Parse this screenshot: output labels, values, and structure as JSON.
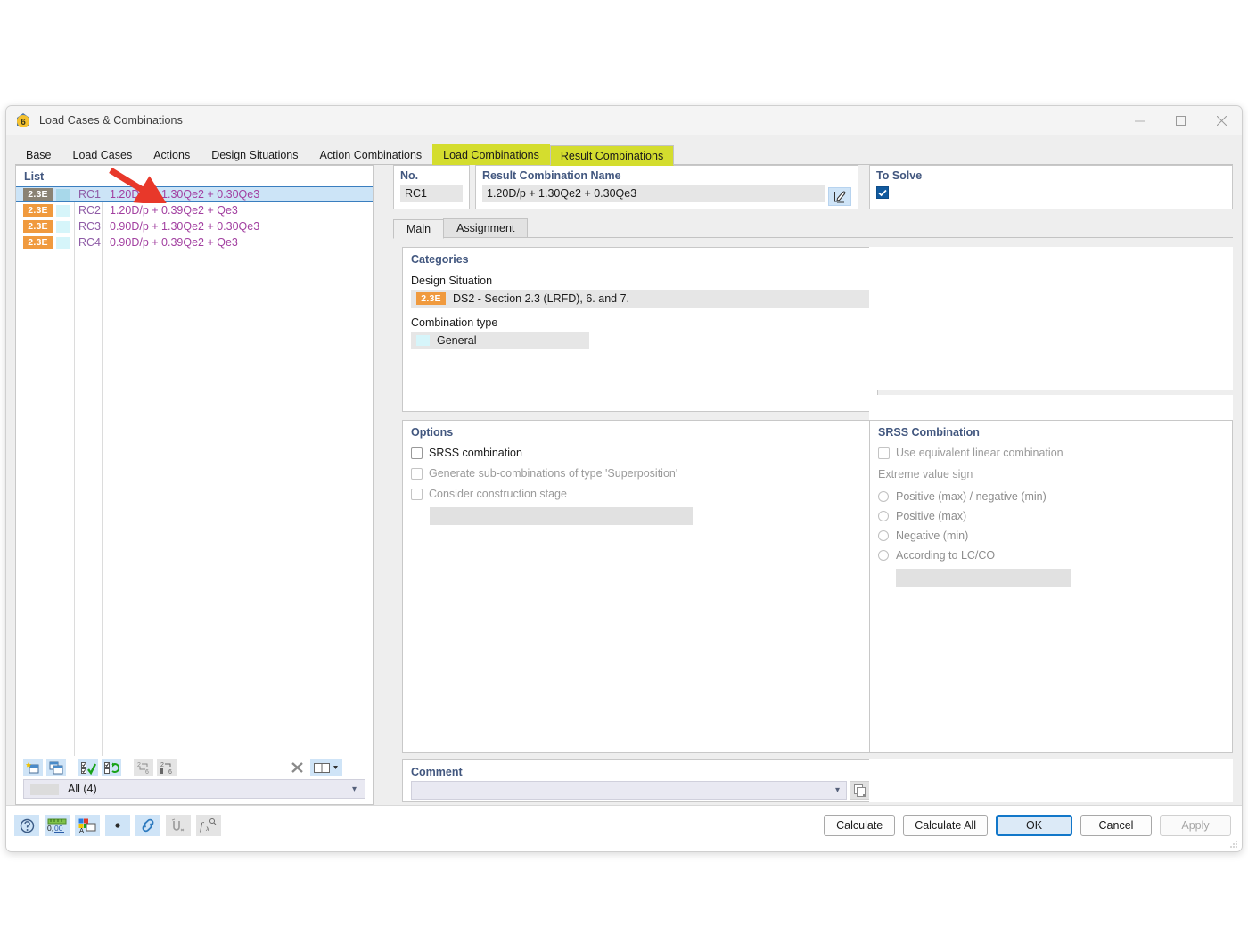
{
  "window": {
    "title": "Load Cases & Combinations",
    "app_icon": "rfem6-logo-icon",
    "minimize": "—",
    "maximize": "□",
    "close": "✕"
  },
  "tabs": [
    {
      "label": "Base",
      "highlight": false,
      "active": false
    },
    {
      "label": "Load Cases",
      "highlight": false,
      "active": false
    },
    {
      "label": "Actions",
      "highlight": false,
      "active": false
    },
    {
      "label": "Design Situations",
      "highlight": false,
      "active": false
    },
    {
      "label": "Action Combinations",
      "highlight": false,
      "active": false
    },
    {
      "label": "Load Combinations",
      "highlight": true,
      "active": false
    },
    {
      "label": "Result Combinations",
      "highlight": true,
      "active": true
    }
  ],
  "list": {
    "caption": "List",
    "rows": [
      {
        "badge": "2.3E",
        "no": "RC1",
        "description": "1.20D/p + 1.30Qe2 + 0.30Qe3",
        "selected": true
      },
      {
        "badge": "2.3E",
        "no": "RC2",
        "description": "1.20D/p + 0.39Qe2 + Qe3",
        "selected": false
      },
      {
        "badge": "2.3E",
        "no": "RC3",
        "description": "0.90D/p + 1.30Qe2 + 0.30Qe3",
        "selected": false
      },
      {
        "badge": "2.3E",
        "no": "RC4",
        "description": "0.90D/p + 0.39Qe2 + Qe3",
        "selected": false
      }
    ],
    "toolbar": [
      {
        "name": "new-result-combination-icon",
        "enabled": true
      },
      {
        "name": "copy-result-combination-icon",
        "enabled": true
      },
      {
        "name": "select-all-icon",
        "enabled": true
      },
      {
        "name": "invert-selection-icon",
        "enabled": true
      },
      {
        "name": "renumber-icon",
        "enabled": false
      },
      {
        "name": "sort-numbering-icon",
        "enabled": false
      },
      {
        "name": "delete-icon",
        "enabled": false
      },
      {
        "name": "table-view-icon",
        "enabled": true
      }
    ],
    "filter_value": "All (4)"
  },
  "header": {
    "no_label": "No.",
    "no_value": "RC1",
    "name_label": "Result Combination Name",
    "name_value": "1.20D/p + 1.30Qe2 + 0.30Qe3",
    "edit_icon": "pencil-edit-icon",
    "to_solve_label": "To Solve",
    "to_solve_checked": true
  },
  "inner_tabs": [
    {
      "label": "Main",
      "active": true
    },
    {
      "label": "Assignment",
      "active": false
    }
  ],
  "categories": {
    "title": "Categories",
    "design_situation_label": "Design Situation",
    "design_situation_badge": "2.3E",
    "design_situation_value": "DS2 - Section 2.3 (LRFD), 6. and 7.",
    "combination_type_label": "Combination type",
    "combination_type_value": "General"
  },
  "options": {
    "title": "Options",
    "items": [
      {
        "label": "SRSS combination",
        "checked": false,
        "enabled": true
      },
      {
        "label": "Generate sub-combinations of type 'Superposition'",
        "checked": false,
        "enabled": false
      },
      {
        "label": "Consider construction stage",
        "checked": false,
        "enabled": false
      }
    ],
    "stage_value": ""
  },
  "srss": {
    "title": "SRSS Combination",
    "use_equivalent_label": "Use equivalent linear combination",
    "use_equivalent_checked": false,
    "extreme_value_label": "Extreme value sign",
    "radios": [
      {
        "label": "Positive (max) / negative (min)",
        "selected": false
      },
      {
        "label": "Positive (max)",
        "selected": false
      },
      {
        "label": "Negative (min)",
        "selected": false
      },
      {
        "label": "According to LC/CO",
        "selected": false
      }
    ],
    "lcco_value": ""
  },
  "comment": {
    "title": "Comment",
    "value": "",
    "copy_icon": "copy-comment-icon"
  },
  "footer": {
    "icons": [
      {
        "name": "info-help-icon",
        "enabled": true
      },
      {
        "name": "units-decimals-icon",
        "enabled": true
      },
      {
        "name": "colors-display-icon",
        "enabled": true
      },
      {
        "name": "point-marker-icon",
        "enabled": true
      },
      {
        "name": "link-icon",
        "enabled": true
      },
      {
        "name": "snap-icon",
        "enabled": false
      },
      {
        "name": "formula-fx-icon",
        "enabled": false
      }
    ],
    "buttons": [
      {
        "label": "Calculate",
        "style": "normal",
        "enabled": true
      },
      {
        "label": "Calculate All",
        "style": "normal",
        "enabled": true
      },
      {
        "label": "OK",
        "style": "primary",
        "enabled": true
      },
      {
        "label": "Cancel",
        "style": "normal",
        "enabled": true
      },
      {
        "label": "Apply",
        "style": "disabled",
        "enabled": false
      }
    ]
  },
  "annotation": {
    "arrow_color": "#e8382a",
    "arrow_target": "first-list-row"
  },
  "colors": {
    "tab_highlight": "#d4dd2e",
    "badge_orange": "#f09a3e",
    "badge_selected": "#8a8273",
    "row_selection": "#cce4f7",
    "section_title": "#42577f",
    "row_number": "#8e5ba6",
    "row_description": "#a23fa0",
    "checkbox_blue": "#10599e",
    "arrow_red": "#e8382a"
  }
}
